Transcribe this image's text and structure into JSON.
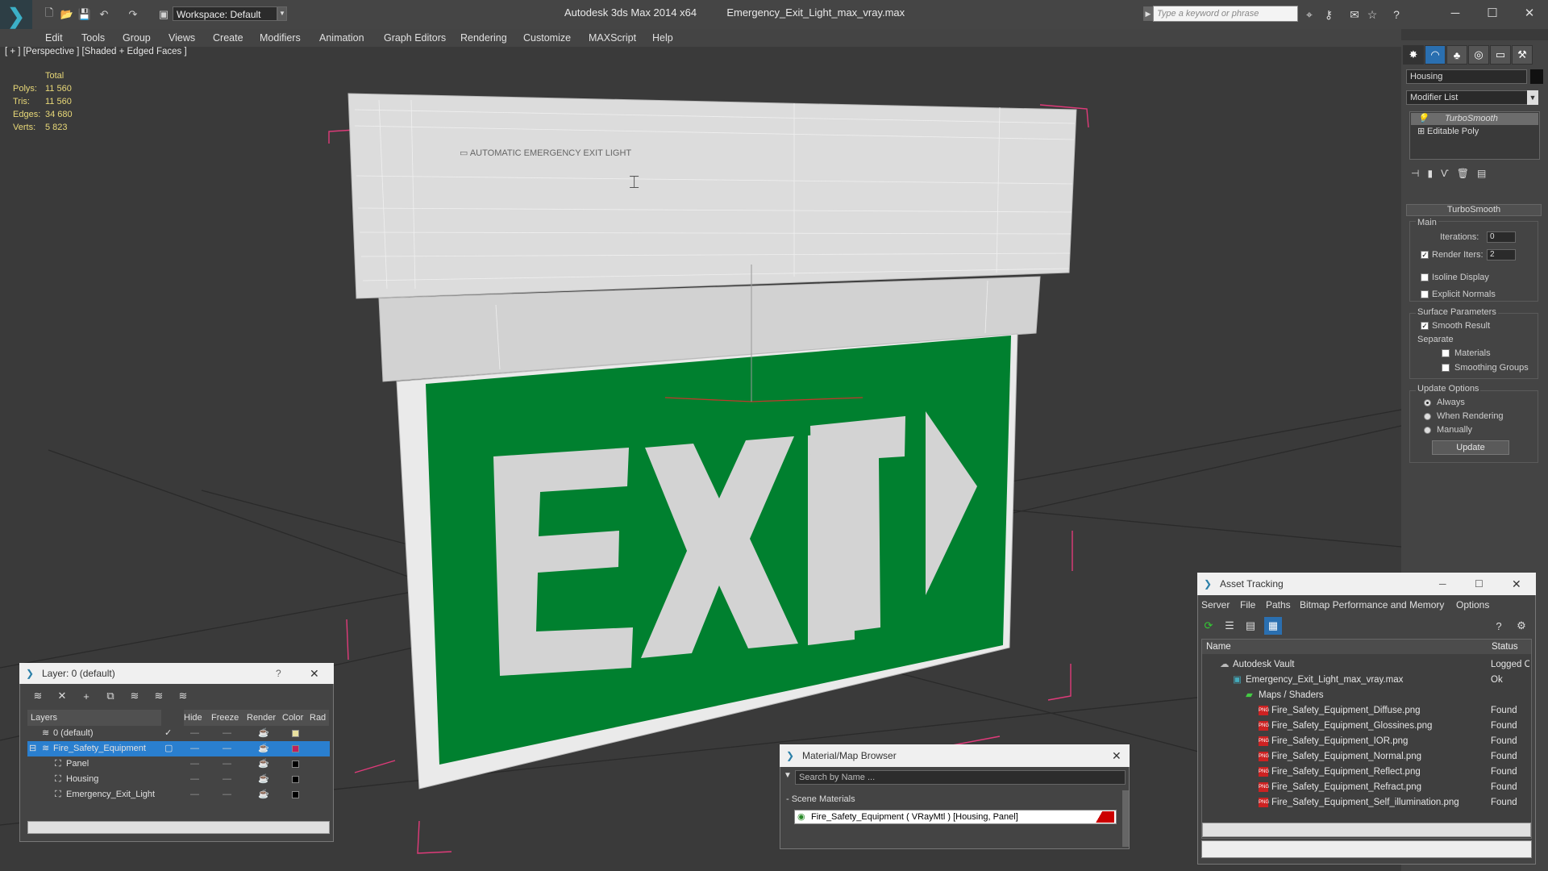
{
  "titlebar": {
    "workspace_label": "Workspace: Default",
    "app_title": "Autodesk 3ds Max  2014 x64",
    "file_title": "Emergency_Exit_Light_max_vray.max",
    "search_placeholder": "Type a keyword or phrase"
  },
  "menu": [
    "Edit",
    "Tools",
    "Group",
    "Views",
    "Create",
    "Modifiers",
    "Animation",
    "Graph Editors",
    "Rendering",
    "Customize",
    "MAXScript",
    "Help"
  ],
  "viewport": {
    "label": "[ + ] [Perspective ] [Shaded + Edged Faces ]",
    "stats_header": "Total",
    "stats": [
      {
        "label": "Polys:",
        "value": "11 560"
      },
      {
        "label": "Tris:",
        "value": "11 560"
      },
      {
        "label": "Edges:",
        "value": "34 680"
      },
      {
        "label": "Verts:",
        "value": "5 823"
      }
    ],
    "sign_text": "EXIT",
    "colors": {
      "sign_green": "#00802f",
      "letters": "#d3d3d3",
      "bbox": "#e03a7a"
    }
  },
  "command_panel": {
    "object_name": "Housing",
    "modifier_list": "Modifier List",
    "stack": [
      {
        "label": "TurboSmooth",
        "active": true
      },
      {
        "label": "Editable Poly",
        "active": false
      }
    ],
    "rollout_title": "TurboSmooth",
    "main_group": "Main",
    "iterations_label": "Iterations:",
    "iterations_value": "0",
    "render_iters_label": "Render Iters:",
    "render_iters_value": "2",
    "isoline_label": "Isoline Display",
    "explicit_normals_label": "Explicit Normals",
    "surface_group": "Surface Parameters",
    "smooth_result_label": "Smooth Result",
    "separate_label": "Separate",
    "materials_label": "Materials",
    "smoothing_groups_label": "Smoothing Groups",
    "update_group": "Update Options",
    "always_label": "Always",
    "when_rendering_label": "When Rendering",
    "manually_label": "Manually",
    "update_button": "Update"
  },
  "layer_window": {
    "title": "Layer: 0 (default)",
    "help": "?",
    "columns": [
      "Layers",
      "Hide",
      "Freeze",
      "Render",
      "Color",
      "Rad"
    ],
    "rows": [
      {
        "name": "0 (default)",
        "color": "#e8e0a0",
        "selected": false,
        "indent": 0,
        "current": true
      },
      {
        "name": "Fire_Safety_Equipment",
        "color": "#c0205a",
        "selected": true,
        "indent": 0,
        "current": false
      },
      {
        "name": "Panel",
        "color": "#000000",
        "selected": false,
        "indent": 1,
        "current": false
      },
      {
        "name": "Housing",
        "color": "#000000",
        "selected": false,
        "indent": 1,
        "current": false
      },
      {
        "name": "Emergency_Exit_Light",
        "color": "#000000",
        "selected": false,
        "indent": 1,
        "current": false
      }
    ]
  },
  "material_browser": {
    "title": "Material/Map Browser",
    "search_placeholder": "Search by Name ...",
    "section": "- Scene Materials",
    "item": "Fire_Safety_Equipment  ( VRayMtl )  [Housing, Panel]"
  },
  "asset_tracking": {
    "title": "Asset Tracking",
    "menu": [
      "Server",
      "File",
      "Paths",
      "Bitmap Performance and Memory",
      "Options"
    ],
    "columns": [
      "Name",
      "Status"
    ],
    "rows": [
      {
        "name": "Autodesk Vault",
        "status": "Logged O",
        "indent": 1,
        "icon": "vault"
      },
      {
        "name": "Emergency_Exit_Light_max_vray.max",
        "status": "Ok",
        "indent": 2,
        "icon": "max"
      },
      {
        "name": "Maps / Shaders",
        "status": "",
        "indent": 3,
        "icon": "folder"
      },
      {
        "name": "Fire_Safety_Equipment_Diffuse.png",
        "status": "Found",
        "indent": 4,
        "icon": "png"
      },
      {
        "name": "Fire_Safety_Equipment_Glossines.png",
        "status": "Found",
        "indent": 4,
        "icon": "png"
      },
      {
        "name": "Fire_Safety_Equipment_IOR.png",
        "status": "Found",
        "indent": 4,
        "icon": "png"
      },
      {
        "name": "Fire_Safety_Equipment_Normal.png",
        "status": "Found",
        "indent": 4,
        "icon": "png"
      },
      {
        "name": "Fire_Safety_Equipment_Reflect.png",
        "status": "Found",
        "indent": 4,
        "icon": "png"
      },
      {
        "name": "Fire_Safety_Equipment_Refract.png",
        "status": "Found",
        "indent": 4,
        "icon": "png"
      },
      {
        "name": "Fire_Safety_Equipment_Self_illumination.png",
        "status": "Found",
        "indent": 4,
        "icon": "png"
      }
    ]
  }
}
